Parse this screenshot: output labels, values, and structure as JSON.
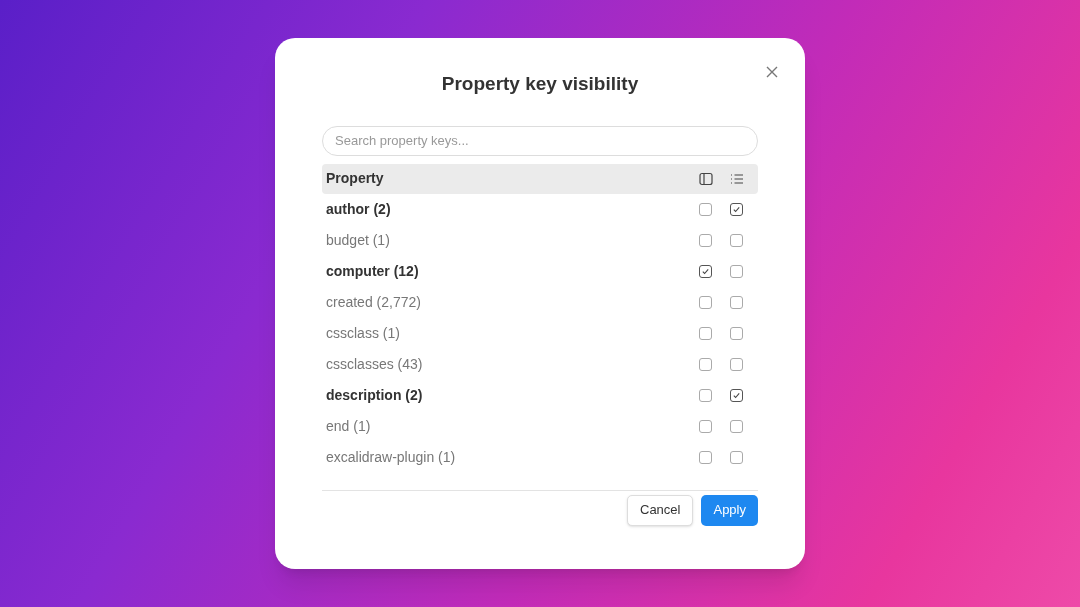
{
  "dialog": {
    "title": "Property key visibility",
    "search": {
      "placeholder": "Search property keys..."
    },
    "header": {
      "label": "Property"
    },
    "rows": [
      {
        "label": "author (2)",
        "sidebar": false,
        "list": true
      },
      {
        "label": "budget (1)",
        "sidebar": false,
        "list": false
      },
      {
        "label": "computer (12)",
        "sidebar": true,
        "list": false
      },
      {
        "label": "created (2,772)",
        "sidebar": false,
        "list": false
      },
      {
        "label": "cssclass (1)",
        "sidebar": false,
        "list": false
      },
      {
        "label": "cssclasses (43)",
        "sidebar": false,
        "list": false
      },
      {
        "label": "description (2)",
        "sidebar": false,
        "list": true
      },
      {
        "label": "end (1)",
        "sidebar": false,
        "list": false
      },
      {
        "label": "excalidraw-plugin (1)",
        "sidebar": false,
        "list": false
      }
    ],
    "buttons": [
      {
        "label": "Cancel",
        "kind": "secondary"
      },
      {
        "label": "Apply",
        "kind": "primary"
      }
    ]
  }
}
